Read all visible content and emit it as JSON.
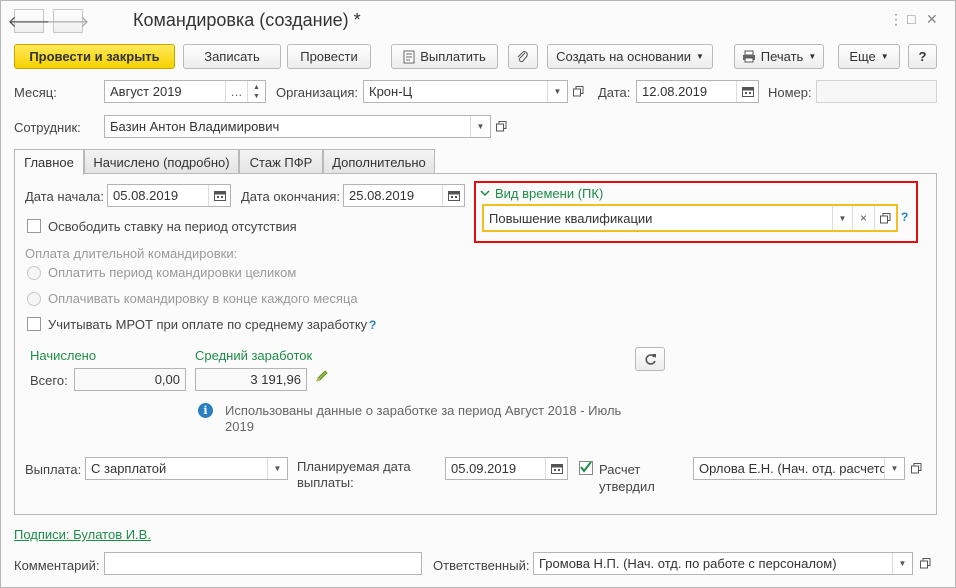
{
  "window": {
    "title": "Командировка (создание) *",
    "controls": [
      "⋮",
      "□",
      "✕"
    ]
  },
  "toolbar": {
    "post_close": "Провести и закрыть",
    "save": "Записать",
    "post": "Провести",
    "pay": "Выплатить",
    "create_based": "Создать на основании",
    "print": "Печать",
    "more": "Еще",
    "help": "?"
  },
  "header": {
    "month_label": "Месяц:",
    "month_value": "Август 2019",
    "org_label": "Организация:",
    "org_value": "Крон-Ц",
    "date_label": "Дата:",
    "date_value": "12.08.2019",
    "number_label": "Номер:",
    "number_value": "",
    "employee_label": "Сотрудник:",
    "employee_value": "Базин Антон Владимирович"
  },
  "tabs": [
    {
      "label": "Главное"
    },
    {
      "label": "Начислено (подробно)"
    },
    {
      "label": "Стаж ПФР"
    },
    {
      "label": "Дополнительно"
    }
  ],
  "main": {
    "start_label": "Дата начала:",
    "start_value": "05.08.2019",
    "end_label": "Дата окончания:",
    "end_value": "25.08.2019",
    "release_rate_label": "Освободить ставку на период отсутствия",
    "long_trip_label": "Оплата длительной командировки:",
    "radio1_label": "Оплатить период командировки целиком",
    "radio2_label": "Оплачивать командировку в конце каждого месяца",
    "mrot_label": "Учитывать МРОТ при оплате по среднему заработку",
    "time_type_label": "Вид времени (ПК)",
    "time_type_value": "Повышение квалификации",
    "accrued_label": "Начислено",
    "avg_earnings_label": "Средний заработок",
    "total_label": "Всего:",
    "total_value": "0,00",
    "avg_value": "3 191,96",
    "info_text_1": "Использованы данные о заработке за период Август 2018 - Июль",
    "info_text_2": "2019",
    "payout_label": "Выплата:",
    "payout_value": "С зарплатой",
    "planned_date_label_1": "Планируемая дата",
    "planned_date_label_2": "выплаты:",
    "planned_date_value": "05.09.2019",
    "approved_label_1": "Расчет",
    "approved_label_2": "утвердил",
    "approved_by_value": "Орлова Е.Н. (Нач. отд. расчетов"
  },
  "footer": {
    "signatures_link": "Подписи: Булатов И.В.",
    "comment_label": "Комментарий:",
    "comment_value": "",
    "responsible_label": "Ответственный:",
    "responsible_value": "Громова Н.П. (Нач. отд. по работе с персоналом)"
  },
  "colors": {
    "primary_button": "#f5d200",
    "highlight_border": "#e01010",
    "accent_green": "#1d8c47",
    "focus_yellow": "#f0c020"
  }
}
